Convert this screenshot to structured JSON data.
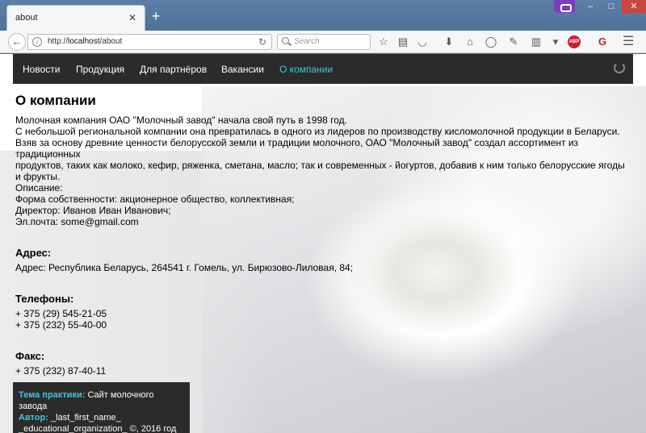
{
  "browser": {
    "tab_title": "about",
    "url_prefix": "http://",
    "url_host": "localhost",
    "url_path": "/about",
    "search_placeholder": "Search"
  },
  "site_nav": {
    "items": [
      {
        "label": "Новости"
      },
      {
        "label": "Продукция"
      },
      {
        "label": "Для партнёров"
      },
      {
        "label": "Вакансии"
      },
      {
        "label": "О компании",
        "active": true
      }
    ]
  },
  "about": {
    "title": "О компании",
    "lines": [
      "Молочная компания ОАО \"Молочный завод\" начала свой путь в 1998 год.",
      "С небольшой региональной компании она превратилась в одного из лидеров по производству кисломолочной продукции в Беларуси.",
      "Взяв за основу древние ценности белорусской земли и традиции молочного, ОАО \"Молочный завод\" создал ассортимент из традиционных",
      "продуктов, таких как молоко, кефир, ряженка, сметана, масло; так и современных - йогуртов, добавив к ним только белорусские ягоды и фрукты.",
      "Описание:",
      "Форма собственности: акционерное общество, коллективная;",
      "Директор: Иванов Иван Иванович;",
      "Эл.почта: some@gmail.com"
    ],
    "address_heading": "Адрес:",
    "address": "Адрес: Республика Беларусь, 264541 г. Гомель, ул. Бирюзово-Лиловая, 84;",
    "phones_heading": "Телефоны:",
    "phones": [
      "+ 375 (29) 545-21-05",
      "+ 375 (232) 55-40-00"
    ],
    "fax_heading": "Факс:",
    "fax": "+ 375 (232) 87-40-11"
  },
  "footer": {
    "topic_label": "Тема практики:",
    "topic_value": "Сайт молочного завода",
    "author_label": "Автор:",
    "author_value": "_last_first_name_",
    "org_line": "_educational_organization_ ©, 2016 год"
  },
  "colors": {
    "nav_bg": "#2b2b2b",
    "accent": "#3ec6e0"
  }
}
